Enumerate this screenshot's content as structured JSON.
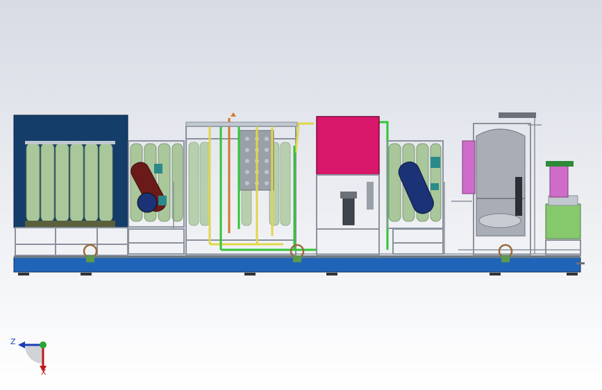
{
  "viewport": {
    "background_top": "#d7dbe4",
    "background_bottom": "#ffffff"
  },
  "model": {
    "description_icon": "water-treatment-skid-model",
    "colors": {
      "skid_base": "#1f64b8",
      "skid_base_dark": "#103c78",
      "frame": "#8a919c",
      "membrane": "#a9c79a",
      "enclosure": "#143d6a",
      "magenta_panel": "#d8176b",
      "dark_red_vessel": "#6b1a1a",
      "navy_vessel": "#1b3277",
      "grey_tank": "#a8adb6",
      "green_tank": "#86c86c",
      "pink_tank": "#cf6cc9",
      "pipe_yellow": "#e1d64a",
      "pipe_green": "#32c436",
      "pipe_orange": "#d2782a",
      "teal_fitting": "#2a8a8a"
    }
  },
  "triad": {
    "z_label": "Z",
    "x_label": "X",
    "z_color": "#1a3cb8",
    "x_color": "#c01818",
    "y_color": "#2aa636"
  }
}
